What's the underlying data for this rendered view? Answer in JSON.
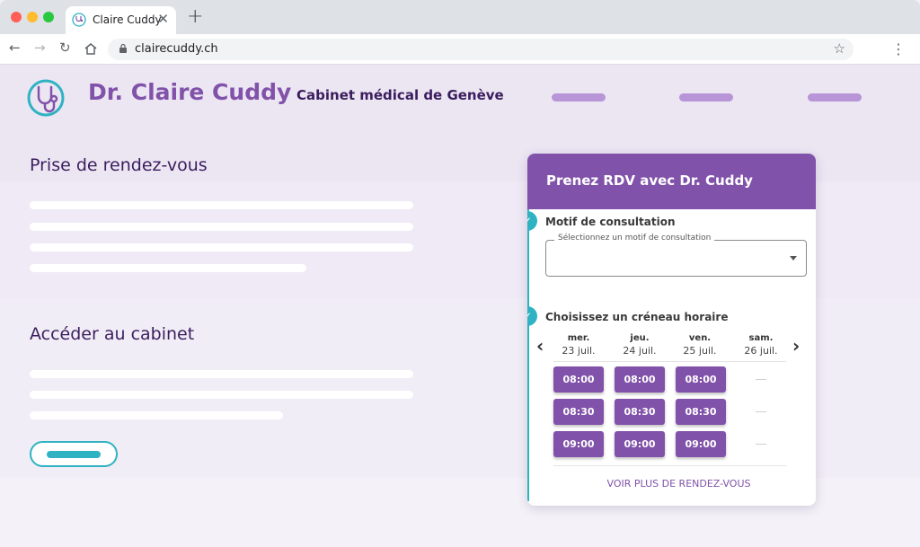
{
  "browser": {
    "tab_title": "Claire Cuddy",
    "new_tab": "+",
    "close": "✕",
    "url": "clairecuddy.ch"
  },
  "site": {
    "brand": "Dr. Claire Cuddy",
    "subtitle": "Cabinet médical de Genève"
  },
  "sections": {
    "appointments": "Prise de rendez-vous",
    "access": "Accéder au cabinet"
  },
  "booking": {
    "title": "Prenez RDV avec Dr. Cuddy",
    "step1": "Motif de consultation",
    "select_label": "Sélectionnez un motif de consultation",
    "step2": "Choisissez un créneau horaire",
    "days": [
      {
        "name": "mer.",
        "date": "23 juil."
      },
      {
        "name": "jeu.",
        "date": "24 juil."
      },
      {
        "name": "ven.",
        "date": "25 juil."
      },
      {
        "name": "sam.",
        "date": "26 juil."
      }
    ],
    "times": [
      "08:00",
      "08:30",
      "09:00"
    ],
    "more": "VOIR PLUS DE RENDEZ-VOUS"
  },
  "colors": {
    "brand_purple": "#8152a9",
    "teal": "#2fb3c2",
    "dark_purple": "#3b1d5e"
  }
}
